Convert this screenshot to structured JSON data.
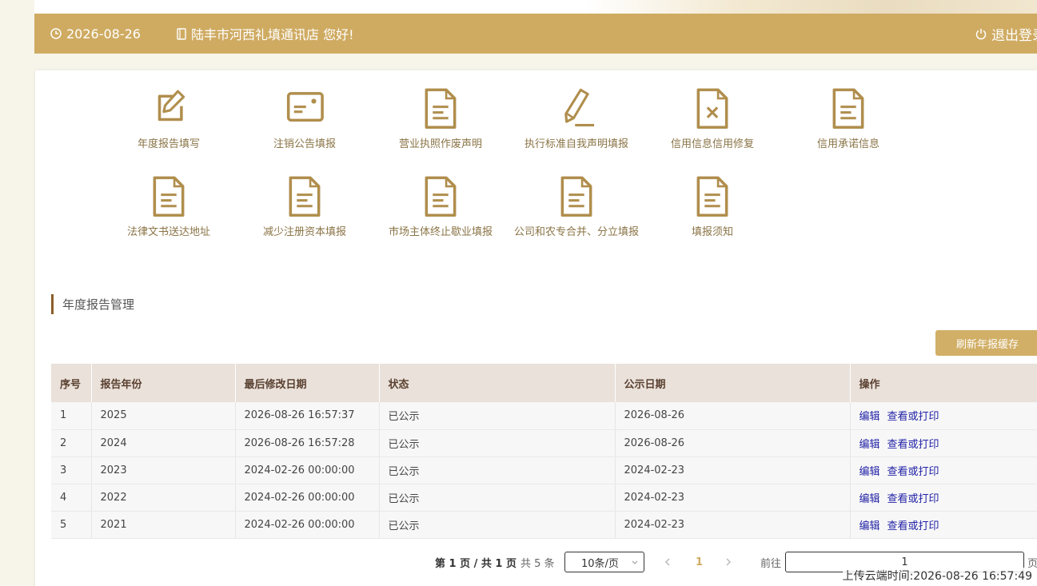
{
  "header": {
    "date": "2026-08-26",
    "greeting": "陆丰市河西礼填通讯店 您好!",
    "logout_label": "退出登录"
  },
  "functions": [
    {
      "label": "年度报告填写",
      "icon": "edit-icon"
    },
    {
      "label": "注销公告填报",
      "icon": "id-card-icon"
    },
    {
      "label": "营业执照作废声明",
      "icon": "document-icon"
    },
    {
      "label": "执行标准自我声明填报",
      "icon": "pen-icon"
    },
    {
      "label": "信用信息信用修复",
      "icon": "document-x-icon"
    },
    {
      "label": "信用承诺信息",
      "icon": "document-icon"
    },
    {
      "label": "法律文书送达地址",
      "icon": "document-icon"
    },
    {
      "label": "减少注册资本填报",
      "icon": "document-icon"
    },
    {
      "label": "市场主体终止歇业填报",
      "icon": "document-icon"
    },
    {
      "label": "公司和农专合并、分立填报",
      "icon": "document-icon"
    },
    {
      "label": "填报须知",
      "icon": "document-icon"
    }
  ],
  "section_title": "年度报告管理",
  "refresh_label": "刷新年报缓存",
  "table": {
    "headers": [
      "序号",
      "报告年份",
      "最后修改日期",
      "状态",
      "公示日期",
      "操作"
    ],
    "rows": [
      {
        "no": "1",
        "year": "2025",
        "modified": "2026-08-26 16:57:37",
        "status": "已公示",
        "publish": "2026-08-26"
      },
      {
        "no": "2",
        "year": "2024",
        "modified": "2026-08-26 16:57:28",
        "status": "已公示",
        "publish": "2026-08-26"
      },
      {
        "no": "3",
        "year": "2023",
        "modified": "2024-02-26 00:00:00",
        "status": "已公示",
        "publish": "2024-02-23"
      },
      {
        "no": "4",
        "year": "2022",
        "modified": "2024-02-26 00:00:00",
        "status": "已公示",
        "publish": "2024-02-23"
      },
      {
        "no": "5",
        "year": "2021",
        "modified": "2024-02-26 00:00:00",
        "status": "已公示",
        "publish": "2024-02-23"
      }
    ],
    "edit_label": "编辑",
    "view_label": "查看或打印"
  },
  "pagination": {
    "summary": "第 1 页 / 共 1 页",
    "total": "共 5 条",
    "page_size": "10条/页",
    "current_page": "1",
    "goto_label": "前往",
    "goto_value": "1",
    "page_unit": "页"
  },
  "upload_time": "上传云端时间:2026-08-26 16:57:49",
  "colors": {
    "accent": "#cfab62",
    "icon": "#b08e4d",
    "link": "#2323a8"
  }
}
